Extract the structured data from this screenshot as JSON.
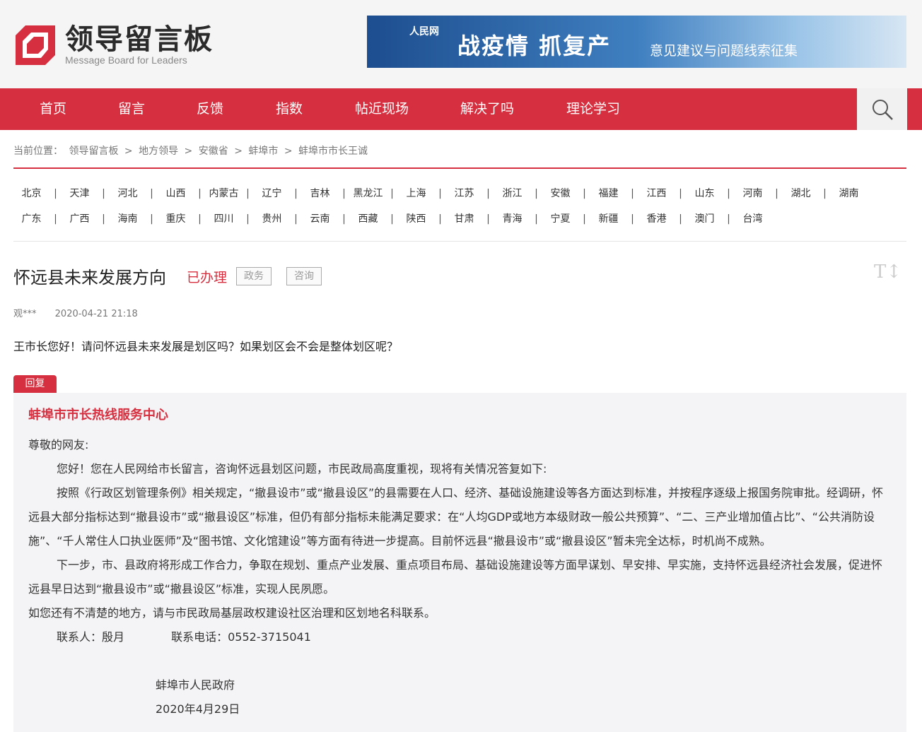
{
  "header": {
    "logo_title": "领导留言板",
    "logo_subtitle": "Message Board for Leaders",
    "banner_source": "人民网",
    "banner_main": "战疫情 抓复产",
    "banner_sub": "意见建议与问题线索征集"
  },
  "nav": {
    "items": [
      {
        "label": "首页"
      },
      {
        "label": "留言"
      },
      {
        "label": "反馈"
      },
      {
        "label": "指数"
      },
      {
        "label": "帖近现场"
      },
      {
        "label": "解决了吗"
      },
      {
        "label": "理论学习"
      }
    ],
    "search_icon": "search-icon",
    "accent_color": "#d62f3f"
  },
  "breadcrumb": {
    "prefix": "当前位置：",
    "items": [
      "领导留言板",
      "地方领导",
      "安徽省",
      "蚌埠市",
      "蚌埠市市长王诚"
    ],
    "separator": ">"
  },
  "provinces": {
    "row1": [
      "北京",
      "天津",
      "河北",
      "山西",
      "内蒙古",
      "辽宁",
      "吉林",
      "黑龙江",
      "上海",
      "江苏",
      "浙江",
      "安徽",
      "福建",
      "江西",
      "山东",
      "河南",
      "湖北",
      "湖南"
    ],
    "row2": [
      "广东",
      "广西",
      "海南",
      "重庆",
      "四川",
      "贵州",
      "云南",
      "西藏",
      "陕西",
      "甘肃",
      "青海",
      "宁夏",
      "新疆",
      "香港",
      "澳门",
      "台湾"
    ]
  },
  "message": {
    "title": "怀远县未来发展方向",
    "status": "已办理",
    "tags": [
      "政务",
      "咨询"
    ],
    "author": "观***",
    "time": "2020-04-21 21:18",
    "content": "王市长您好！请问怀远县未来发展是划区吗？如果划区会不会是整体划区呢？",
    "font_toggle": "T↕"
  },
  "reply": {
    "tab_label": "回复",
    "org": "蚌埠市市长热线服务中心",
    "greeting": "尊敬的网友:",
    "para1": "您好！您在人民网给市长留言，咨询怀远县划区问题，市民政局高度重视，现将有关情况答复如下:",
    "para2": "按照《行政区划管理条例》相关规定，“撤县设市”或“撤县设区”的县需要在人口、经济、基础设施建设等各方面达到标准，并按程序逐级上报国务院审批。经调研，怀远县大部分指标达到“撤县设市”或“撤县设区”标准，但仍有部分指标未能满足要求：在“人均GDP或地方本级财政一般公共预算”、“二、三产业增加值占比”、“公共消防设施”、“千人常住人口执业医师”及“图书馆、文化馆建设”等方面有待进一步提高。目前怀远县“撤县设市”或“撤县设区”暂未完全达标，时机尚不成熟。",
    "para3": "下一步，市、县政府将形成工作合力，争取在规划、重点产业发展、重点项目布局、基础设施建设等方面早谋划、早安排、早实施，支持怀远县经济社会发展，促进怀远县早日达到“撤县设市”或“撤县设区”标准，实现人民夙愿。",
    "para4": "如您还有不清楚的地方，请与市民政局基层政权建设社区治理和区划地名科联系。",
    "contact": "联系人：殷月             联系电话：0552-3715041",
    "signature": "蚌埠市人民政府",
    "date": "2020年4月29日"
  }
}
